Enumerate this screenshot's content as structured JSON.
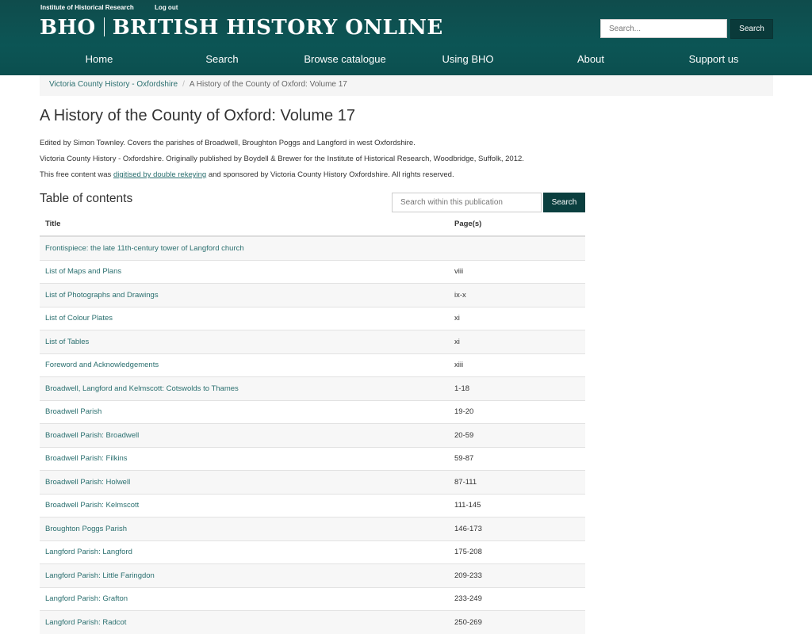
{
  "header": {
    "top_links": [
      "Institute of Historical Research",
      "Log out"
    ],
    "logo_short": "BHO",
    "logo_full": "BRITISH HISTORY ONLINE",
    "search_placeholder": "Search...",
    "search_button": "Search",
    "nav": [
      "Home",
      "Search",
      "Browse catalogue",
      "Using BHO",
      "About",
      "Support us"
    ]
  },
  "breadcrumb": {
    "link": "Victoria County History - Oxfordshire",
    "current": "A History of the County of Oxford: Volume 17"
  },
  "page": {
    "title": "A History of the County of Oxford: Volume 17",
    "desc1": "Edited by Simon Townley. Covers the parishes of Broadwell, Broughton Poggs and Langford in west Oxfordshire.",
    "desc2": "Victoria County History - Oxfordshire. Originally published by Boydell & Brewer for the Institute of Historical Research, Woodbridge, Suffolk, 2012.",
    "desc3_before": "This free content was ",
    "desc3_link": "digitised by double rekeying",
    "desc3_after": " and sponsored by Victoria County History Oxfordshire. All rights reserved."
  },
  "toc": {
    "heading": "Table of contents",
    "search_placeholder": "Search within this publication",
    "search_button": "Search",
    "col_title": "Title",
    "col_pages": "Page(s)",
    "rows": [
      {
        "title": "Frontispiece: the late 11th-century tower of Langford church",
        "pages": ""
      },
      {
        "title": "List of Maps and Plans",
        "pages": "viii"
      },
      {
        "title": "List of Photographs and Drawings",
        "pages": "ix-x"
      },
      {
        "title": "List of Colour Plates",
        "pages": "xi"
      },
      {
        "title": "List of Tables",
        "pages": "xi"
      },
      {
        "title": "Foreword and Acknowledgements",
        "pages": "xiii"
      },
      {
        "title": "Broadwell, Langford and Kelmscott: Cotswolds to Thames",
        "pages": "1-18"
      },
      {
        "title": "Broadwell Parish",
        "pages": "19-20"
      },
      {
        "title": "Broadwell Parish: Broadwell",
        "pages": "20-59"
      },
      {
        "title": "Broadwell Parish: Filkins",
        "pages": "59-87"
      },
      {
        "title": "Broadwell Parish: Holwell",
        "pages": "87-111"
      },
      {
        "title": "Broadwell Parish: Kelmscott",
        "pages": "111-145"
      },
      {
        "title": "Broughton Poggs Parish",
        "pages": "146-173"
      },
      {
        "title": "Langford Parish: Langford",
        "pages": "175-208"
      },
      {
        "title": "Langford Parish: Little Faringdon",
        "pages": "209-233"
      },
      {
        "title": "Langford Parish: Grafton",
        "pages": "233-249"
      },
      {
        "title": "Langford Parish: Radcot",
        "pages": "250-269"
      }
    ]
  }
}
